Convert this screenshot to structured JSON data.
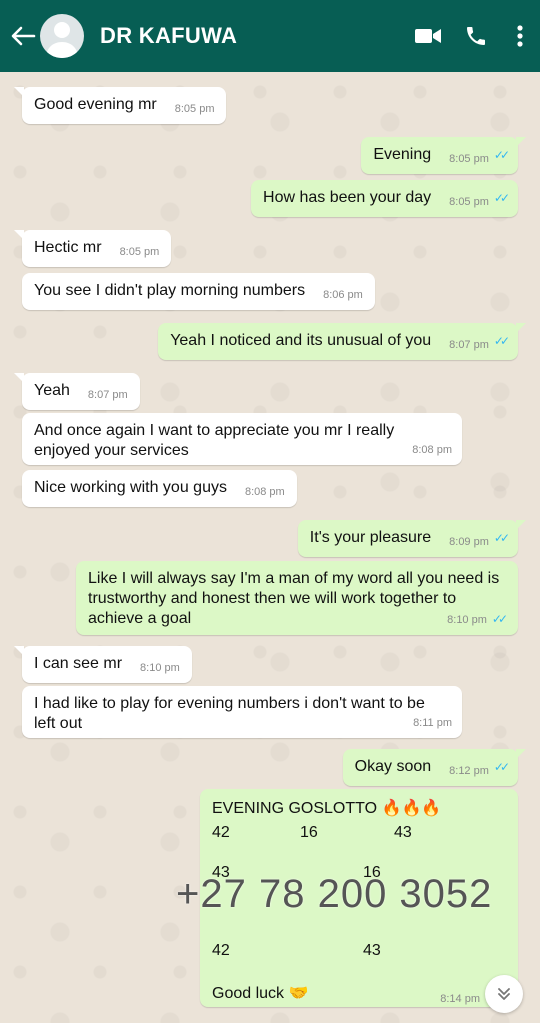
{
  "header": {
    "contact_name": "DR KAFUWA"
  },
  "messages": [
    {
      "text": "Good evening mr",
      "time": "8:05 pm"
    },
    {
      "text": "Evening",
      "time": "8:05 pm"
    },
    {
      "text": "How has been your day",
      "time": "8:05 pm"
    },
    {
      "text": "Hectic mr",
      "time": "8:05 pm"
    },
    {
      "text": "You see I didn't play morning numbers",
      "time": "8:06 pm"
    },
    {
      "text": "Yeah I noticed and its unusual  of you",
      "time": "8:07 pm"
    },
    {
      "text": "Yeah",
      "time": "8:07 pm"
    },
    {
      "text": "And once again I want to appreciate you mr I really enjoyed your services",
      "time": "8:08 pm"
    },
    {
      "text": "Nice working with you guys",
      "time": "8:08 pm"
    },
    {
      "text": "It's your pleasure",
      "time": "8:09 pm"
    },
    {
      "text": "Like I will  always  say I'm a man of  my word  all you need is trustworthy and honest  then we will work together to achieve a goal",
      "time": "8:10 pm"
    },
    {
      "text": "I can see mr",
      "time": "8:10 pm"
    },
    {
      "text": "I had like to play for evening numbers i don't want to be left out",
      "time": "8:11 pm"
    },
    {
      "text": "Okay  soon",
      "time": "8:12 pm"
    }
  ],
  "lotto": {
    "title": "EVENING GOSLOTTO",
    "flames": "🔥🔥🔥",
    "row1": [
      "42",
      "16",
      "43"
    ],
    "row2": [
      "43",
      "16"
    ],
    "row3": [
      "42",
      "43"
    ],
    "good_luck": "Good luck",
    "good_luck_emoji": "🤝",
    "time": "8:14 pm"
  },
  "overlay_phone": "+27 78 200 3052",
  "ticks_glyph": "✓✓",
  "colors": {
    "header": "#075e54",
    "outgoing_bubble": "#dcf8c6",
    "incoming_bubble": "#ffffff",
    "read_ticks": "#34b7f1"
  }
}
